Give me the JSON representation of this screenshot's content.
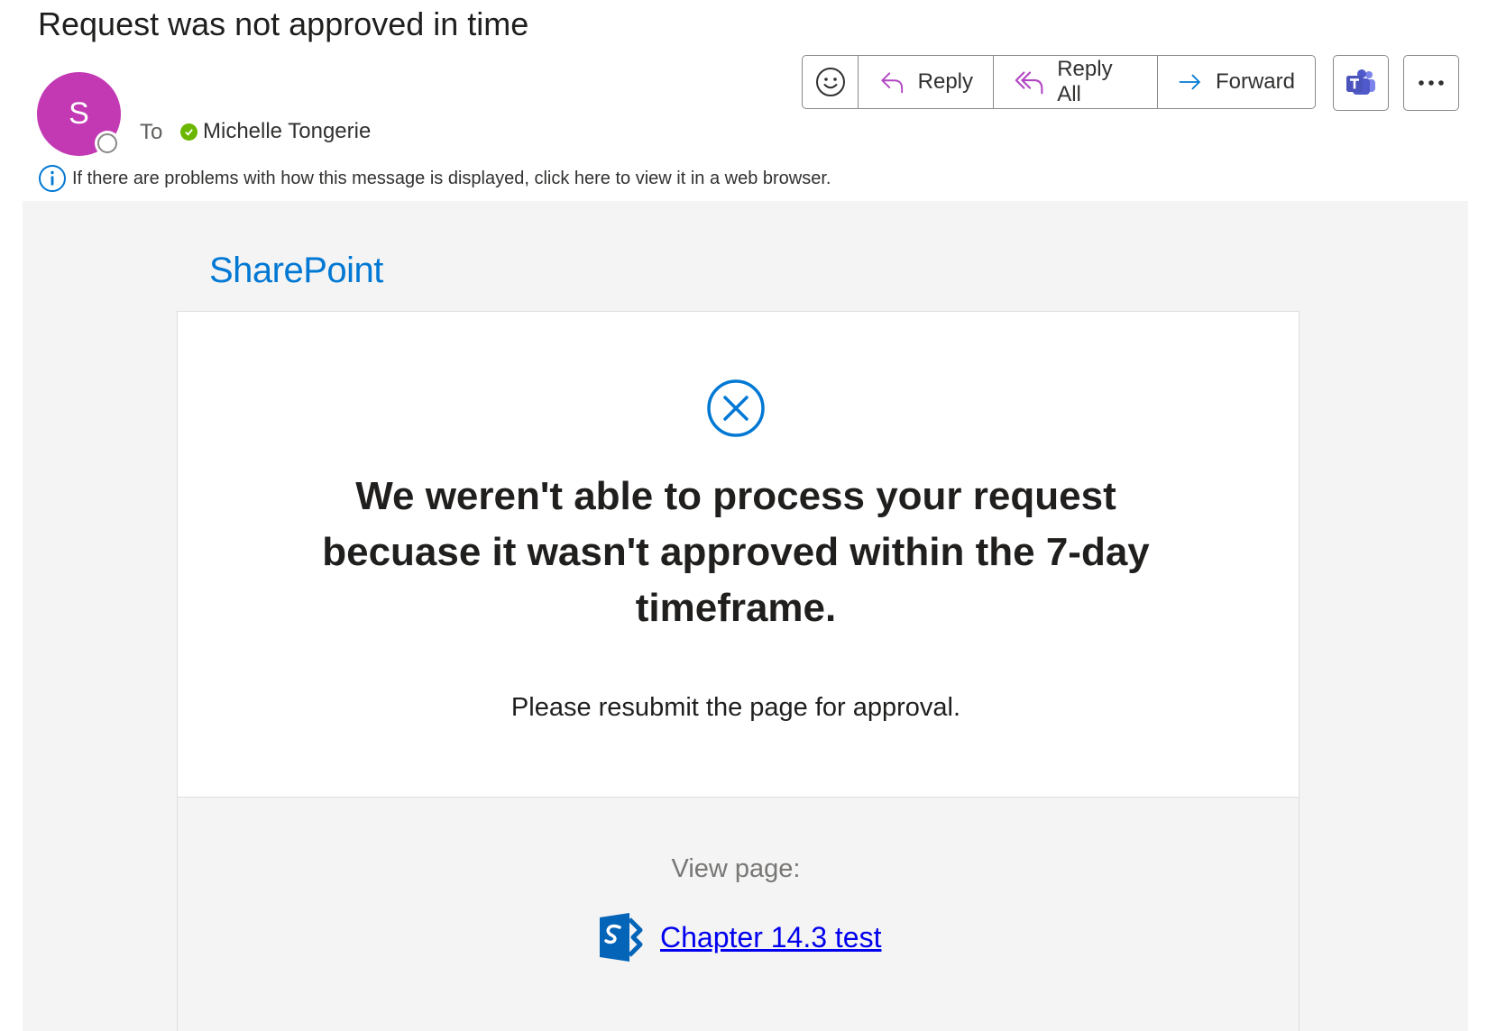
{
  "message": {
    "subject": "Request was not approved in time",
    "sender_initial": "S",
    "to_label": "To",
    "recipient": "Michelle Tongerie",
    "info_bar": "If there are problems with how this message is displayed, click here to view it in a web browser."
  },
  "toolbar": {
    "reply_label": "Reply",
    "reply_all_label": "Reply All",
    "forward_label": "Forward"
  },
  "email_body": {
    "brand": "SharePoint",
    "headline": "We weren't able to process your request becuase it wasn't approved within the 7-day timeframe.",
    "subtext": "Please resubmit the page for approval.",
    "view_label": "View page:",
    "page_link_text": "Chapter 14.3 test"
  },
  "icons": {
    "emoji": "smiley-icon",
    "reply": "reply-arrow-icon",
    "reply_all": "reply-all-arrow-icon",
    "forward": "forward-arrow-icon",
    "teams": "teams-icon",
    "more": "more-dots-icon",
    "info": "info-icon",
    "error": "circle-x-icon",
    "sharepoint": "sharepoint-icon"
  },
  "colors": {
    "avatar": "#c239b3",
    "accent": "#0078d4",
    "reply_purple": "#b146c2",
    "presence_green": "#6bb700",
    "link": "#0000ee"
  }
}
